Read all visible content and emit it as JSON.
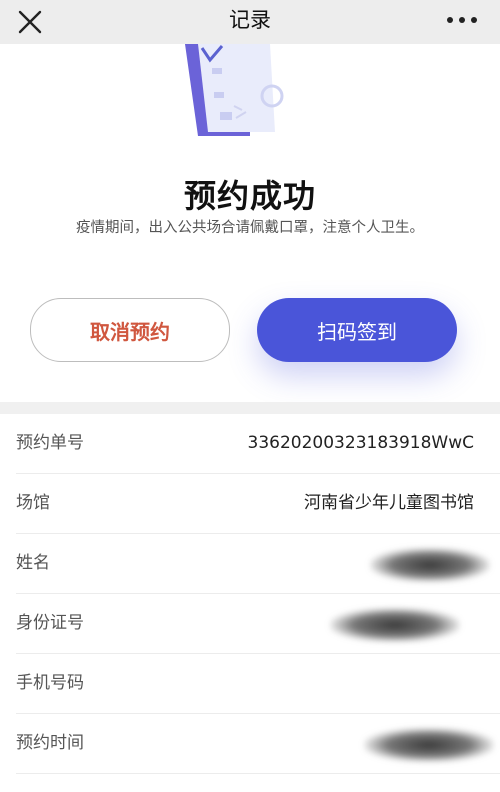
{
  "header": {
    "title": "记录"
  },
  "hero": {
    "title": "预约成功",
    "notice": "疫情期间，出入公共场合请佩戴口罩，注意个人卫生。"
  },
  "actions": {
    "cancel_label": "取消预约",
    "scan_label": "扫码签到"
  },
  "colors": {
    "accent": "#4a55d9",
    "cancel_text": "#d0573f"
  },
  "details": {
    "rows": [
      {
        "label": "预约单号",
        "value": "3362020032318391​8WwC"
      },
      {
        "label": "场馆",
        "value": "河南省少年儿童图书馆"
      },
      {
        "label": "姓名",
        "value": ""
      },
      {
        "label": "身份证号",
        "value": ""
      },
      {
        "label": "手机号码",
        "value": ""
      },
      {
        "label": "预约时间",
        "value": ""
      }
    ]
  }
}
